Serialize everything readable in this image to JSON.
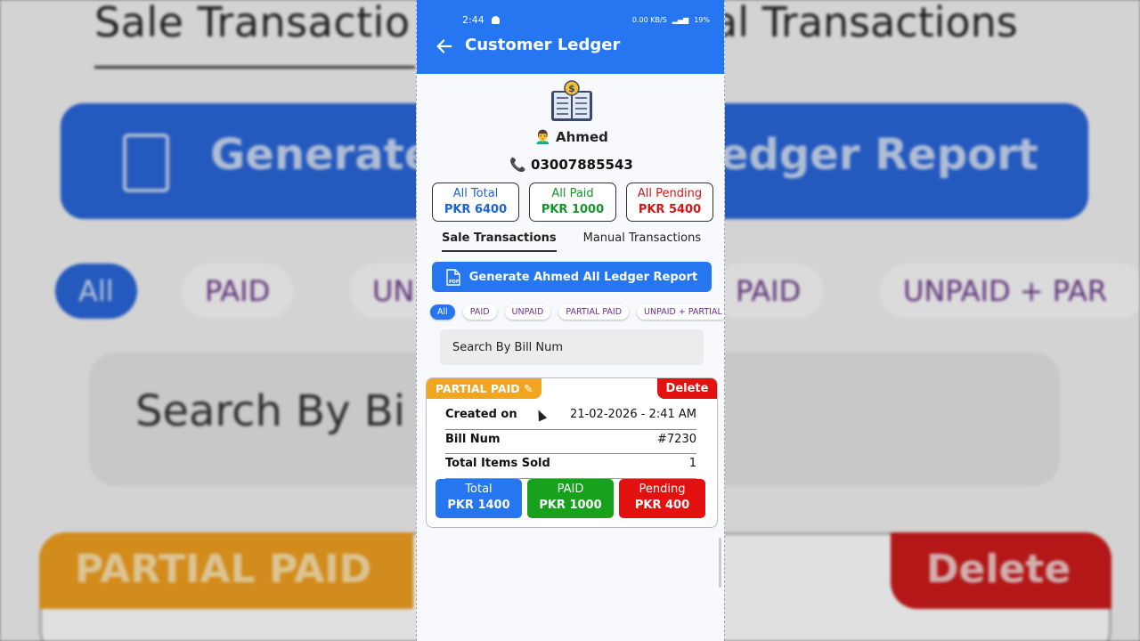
{
  "background": {
    "title_left": "Sale Transactio",
    "title_right": "al Transactions",
    "generate_left": "Generate",
    "generate_right": "edger Report",
    "pills": [
      "All",
      "PAID",
      "UN",
      "PAID",
      "UNPAID + PAR"
    ],
    "search": "Search By Bi",
    "partial": "PARTIAL PAID",
    "delete": "Delete"
  },
  "status_bar": {
    "time": "2:44",
    "net_speed": "0.00 KB/S",
    "battery": "19%"
  },
  "app_bar": {
    "title": "Customer Ledger"
  },
  "customer": {
    "name": "👨‍🦱 Ahmed",
    "phone": "📞 03007885543"
  },
  "summary": [
    {
      "label": "All Total",
      "value": "PKR 6400",
      "color": "#1c63d6"
    },
    {
      "label": "All Paid",
      "value": "PKR 1000",
      "color": "#15952a"
    },
    {
      "label": "All Pending",
      "value": "PKR 5400",
      "color": "#d31717"
    }
  ],
  "tabs": [
    {
      "label": "Sale Transactions",
      "active": true
    },
    {
      "label": "Manual Transactions",
      "active": false
    }
  ],
  "generate_button": {
    "label": "Generate Ahmed All Ledger Report",
    "icon": "pdf-icon"
  },
  "filters": [
    {
      "label": "All",
      "active": true
    },
    {
      "label": "PAID",
      "active": false
    },
    {
      "label": "UNPAID",
      "active": false
    },
    {
      "label": "PARTIAL PAID",
      "active": false
    },
    {
      "label": "UNPAID + PARTIAL",
      "active": false
    }
  ],
  "search": {
    "placeholder": "Search By Bill Num"
  },
  "transaction": {
    "status": "PARTIAL PAID ✎",
    "delete_label": "Delete",
    "rows": [
      {
        "key": "Created on",
        "value": "21-02-2026 - 2:41 AM"
      },
      {
        "key": "Bill Num",
        "value": "#7230"
      },
      {
        "key": "Total Items Sold",
        "value": "1"
      }
    ],
    "tiles": [
      {
        "label": "Total",
        "value": "PKR 1400",
        "color": "#2676f2"
      },
      {
        "label": "PAID",
        "value": "PKR 1000",
        "color": "#17a11d"
      },
      {
        "label": "Pending",
        "value": "PKR 400",
        "color": "#e3110f"
      }
    ]
  },
  "colors": {
    "primary": "#2676f2",
    "partial": "#f2a51e",
    "danger": "#e3110f",
    "success": "#17a11d"
  }
}
